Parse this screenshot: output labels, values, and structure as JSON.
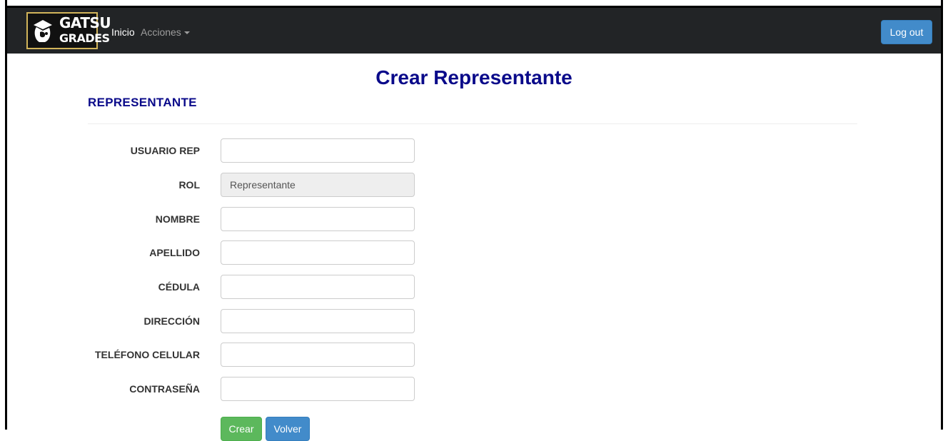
{
  "brand": {
    "line1": "GATSU",
    "line2": "GRADES"
  },
  "nav": {
    "home": "Inicio",
    "actions": "Acciones",
    "logout": "Log out"
  },
  "page": {
    "title": "Crear Representante",
    "section": "REPRESENTANTE"
  },
  "form": {
    "fields": [
      {
        "label": "USUARIO REP",
        "value": ""
      },
      {
        "label": "ROL",
        "value": "Representante"
      },
      {
        "label": "NOMBRE",
        "value": ""
      },
      {
        "label": "APELLIDO",
        "value": ""
      },
      {
        "label": "CÉDULA",
        "value": ""
      },
      {
        "label": "DIRECCIÓN",
        "value": ""
      },
      {
        "label": "TELÉFONO CELULAR",
        "value": ""
      },
      {
        "label": "CONTRASEÑA",
        "value": ""
      }
    ],
    "submit": "Crear",
    "back": "Volver"
  },
  "colors": {
    "navbar": "#222426",
    "primary": "#428bca",
    "success": "#5cb85c",
    "title": "#0a0a8a",
    "brand_border": "#d2b45a"
  }
}
